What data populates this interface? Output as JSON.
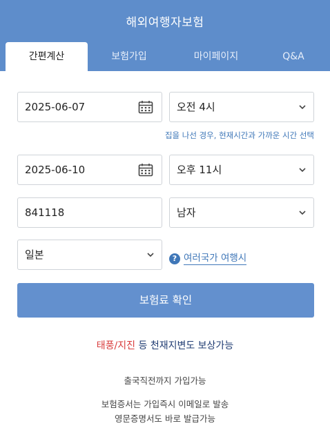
{
  "header": {
    "title": "해외여행자보험"
  },
  "tabs": [
    {
      "label": "간편계산",
      "active": true
    },
    {
      "label": "보험가입",
      "active": false
    },
    {
      "label": "마이페이지",
      "active": false
    },
    {
      "label": "Q&A",
      "active": false
    }
  ],
  "form": {
    "departure_date": "2025-06-07",
    "departure_time": "오전 4시",
    "departure_hint": "집을 나선 경우, 현재시간과 가까운 시간 선택",
    "return_date": "2025-06-10",
    "return_time": "오후 11시",
    "birthdate": "841118",
    "gender": "남자",
    "country": "일본",
    "multi_country_link": "여러국가 여행시"
  },
  "confirm_button": "보험료 확인",
  "promo": {
    "highlight": "태풍/지진",
    "rest": " 등 천재지변도 보상가능"
  },
  "info_lines": [
    "출국직전까지 가입가능",
    "보험증서는 가입즉시 이메일로 발송",
    "영문증명서도 바로 발급가능"
  ],
  "colors": {
    "header_bg": "#5e8dcb",
    "button_bg": "#6390ce",
    "link": "#3f77b8",
    "promo_red": "#d83a3a",
    "promo_navy": "#1f3b72"
  }
}
